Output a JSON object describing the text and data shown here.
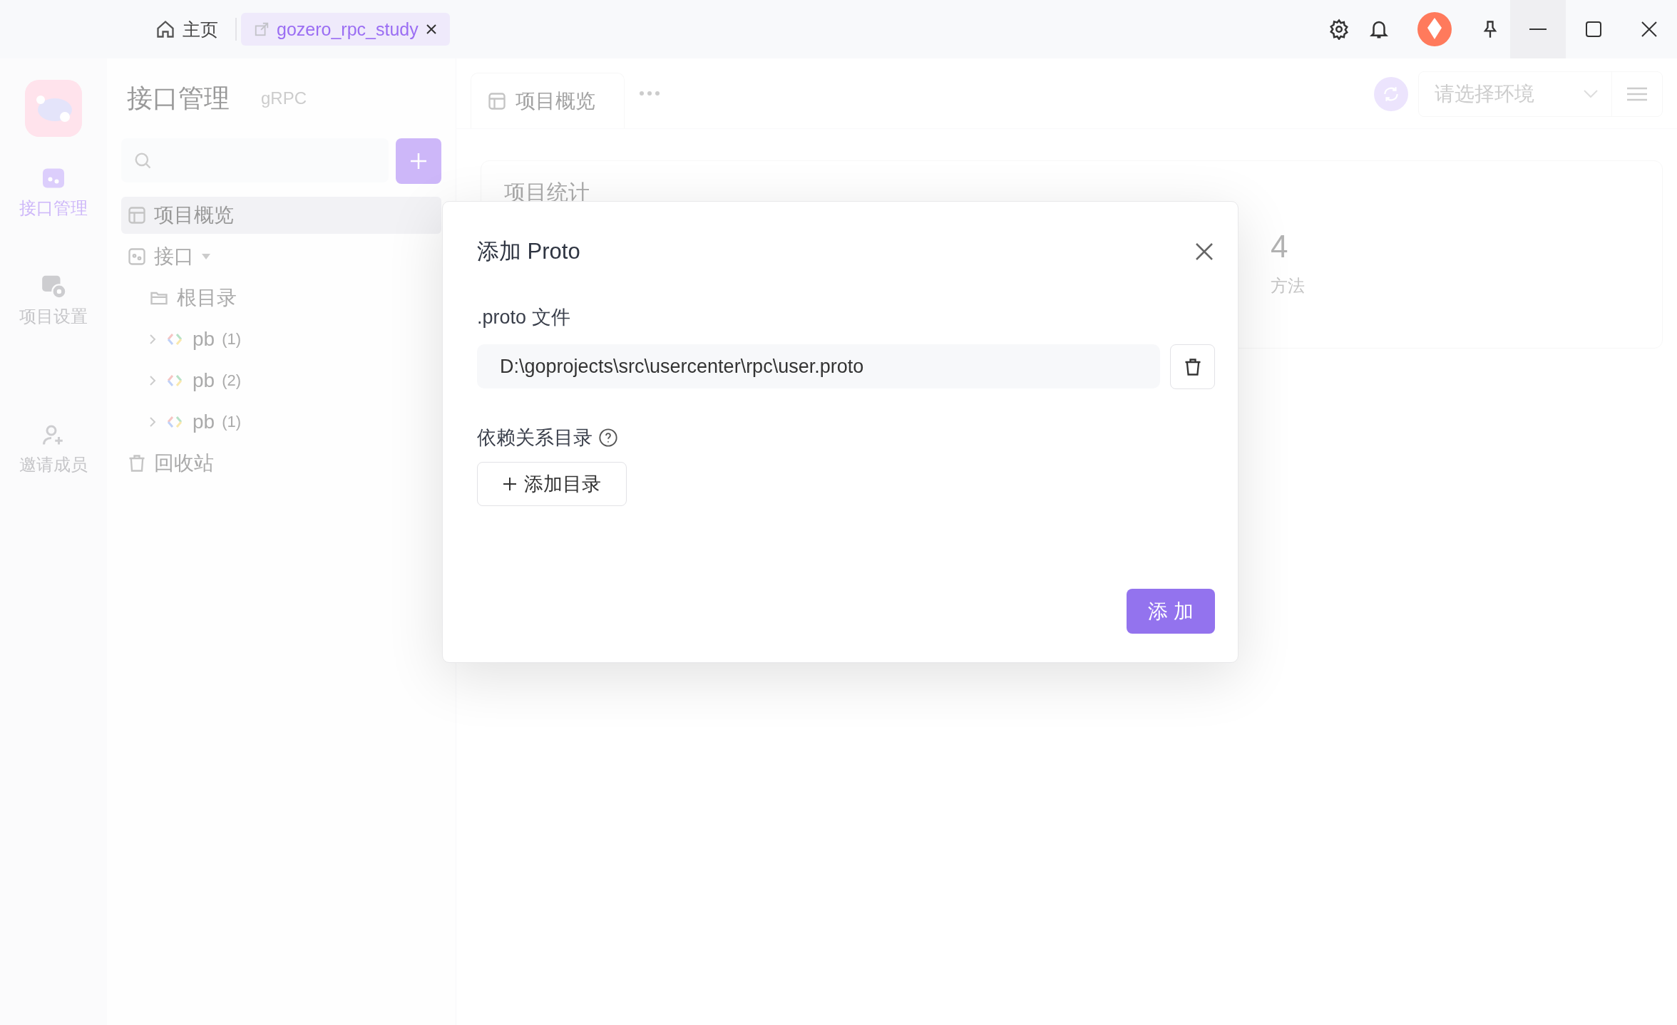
{
  "title_bar": {
    "tabs": [
      {
        "kind": "home",
        "label": "主页",
        "selected": false
      },
      {
        "kind": "project",
        "label": "gozero_rpc_study",
        "selected": true
      }
    ]
  },
  "nav_rail": {
    "items": [
      {
        "kind": "api",
        "label": "接口管理",
        "selected": true
      },
      {
        "kind": "settings",
        "label": "项目设置",
        "selected": false
      },
      {
        "kind": "invite",
        "label": "邀请成员",
        "selected": false
      }
    ]
  },
  "sidebar": {
    "title": "接口管理",
    "subtitle": "gRPC",
    "tree": [
      {
        "kind": "overview",
        "label": "项目概览",
        "selected": true
      },
      {
        "kind": "group",
        "label": "接口",
        "selected": false,
        "expanded": true,
        "children": [
          {
            "kind": "folder",
            "label": "根目录",
            "selected": false
          },
          {
            "kind": "package",
            "label": "pb",
            "count": "(1)",
            "selected": false,
            "expanded": false
          },
          {
            "kind": "package",
            "label": "pb",
            "count": "(2)",
            "selected": false,
            "expanded": false
          },
          {
            "kind": "package",
            "label": "pb",
            "count": "(1)",
            "selected": false,
            "expanded": false
          }
        ]
      },
      {
        "kind": "trash",
        "label": "回收站",
        "selected": false
      }
    ]
  },
  "main": {
    "tabs": [
      {
        "label": "项目概览",
        "selected": true
      }
    ],
    "environment": {
      "placeholder": "请选择环境"
    },
    "stats_card": {
      "title": "项目统计",
      "stats": [
        {
          "value": "4",
          "label": "方法"
        }
      ]
    }
  },
  "dialog": {
    "title": "添加 Proto",
    "proto_label": ".proto 文件",
    "proto_path": "D:\\goprojects\\src\\usercenter\\rpc\\user.proto",
    "deps_label": "依赖关系目录",
    "add_dir_button": "添加目录",
    "submit_button": "添 加"
  }
}
